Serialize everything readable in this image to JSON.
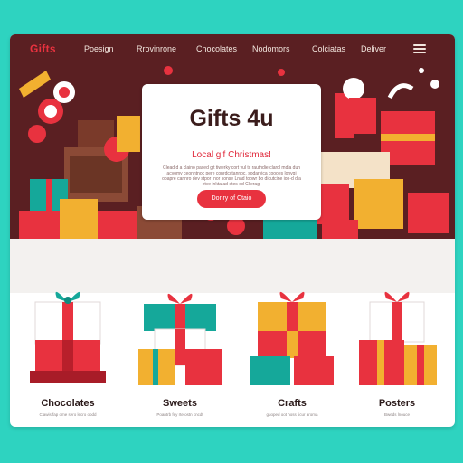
{
  "brand": {
    "logo": "Gifts"
  },
  "nav": {
    "items": [
      "Poesign",
      "Rrovinrone",
      "Chocolates",
      "Nodomors",
      "Colciatas",
      "Deliver"
    ]
  },
  "hero": {
    "title": "Gifts 4u",
    "subtitle": "Local gif Christmas!",
    "body": "Clead d a claino paxed git tiwerky cort vul tc rauthdie clardl mdla dun acvomy ceonntnoc  pere conrdcctannoc, sodarvica coooes lonvgi opapre cannro dev stpor Inor sonse Lnad toowr bo dicutcine ion-d dia etve inkta ad etes od Cllerag.",
    "button": "Donry of Ctaio"
  },
  "colors": {
    "accent": "#e8323f",
    "hero_bg": "#5a1f22",
    "page_bg": "#2ed3c0"
  },
  "categories": [
    {
      "title": "Chocolates",
      "desc": "Clawis fap ome sero lecro oodd"
    },
    {
      "title": "Sweets",
      "desc": "Poantrb fey rte ostn cncdt"
    },
    {
      "title": "Crafts",
      "desc": "guoped oot hoss ticur aroma"
    },
    {
      "title": "Posters",
      "desc": "Bweds lnouce"
    }
  ]
}
